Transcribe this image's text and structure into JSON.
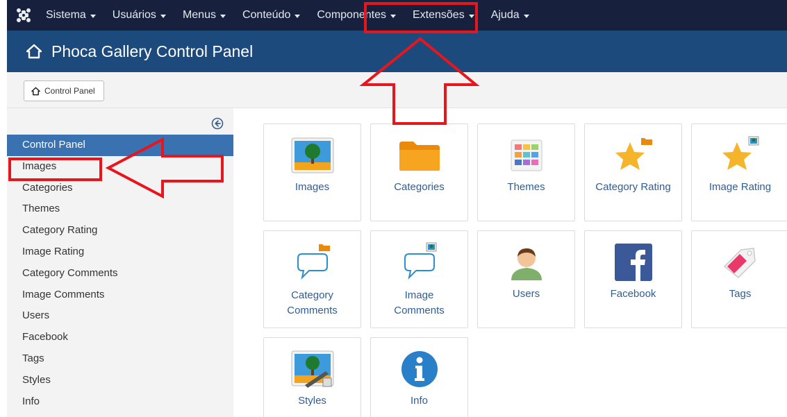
{
  "topnav": {
    "menu": [
      {
        "label": "Sistema"
      },
      {
        "label": "Usuários"
      },
      {
        "label": "Menus"
      },
      {
        "label": "Conteúdo"
      },
      {
        "label": "Componentes"
      },
      {
        "label": "Extensões"
      },
      {
        "label": "Ajuda"
      }
    ]
  },
  "titlebar": {
    "title": "Phoca Gallery Control Panel",
    "icon": "home-icon"
  },
  "toolbar": {
    "control_panel_label": "Control Panel"
  },
  "sidebar": {
    "items": [
      {
        "label": "Control Panel",
        "active": true
      },
      {
        "label": "Images"
      },
      {
        "label": "Categories"
      },
      {
        "label": "Themes"
      },
      {
        "label": "Category Rating"
      },
      {
        "label": "Image Rating"
      },
      {
        "label": "Category Comments"
      },
      {
        "label": "Image Comments"
      },
      {
        "label": "Users"
      },
      {
        "label": "Facebook"
      },
      {
        "label": "Tags"
      },
      {
        "label": "Styles"
      },
      {
        "label": "Info"
      }
    ]
  },
  "tiles": [
    {
      "label": "Images",
      "icon": "image-icon"
    },
    {
      "label": "Categories",
      "icon": "folder-icon"
    },
    {
      "label": "Themes",
      "icon": "themes-grid-icon"
    },
    {
      "label": "Category Rating",
      "icon": "star-folder-icon"
    },
    {
      "label": "Image Rating",
      "icon": "star-image-icon"
    },
    {
      "label": "Category\nComments",
      "icon": "comment-folder-icon"
    },
    {
      "label": "Image\nComments",
      "icon": "comment-image-icon"
    },
    {
      "label": "Users",
      "icon": "user-icon"
    },
    {
      "label": "Facebook",
      "icon": "facebook-icon"
    },
    {
      "label": "Tags",
      "icon": "tag-icon"
    },
    {
      "label": "Styles",
      "icon": "styles-icon"
    },
    {
      "label": "Info",
      "icon": "info-icon"
    }
  ],
  "colors": {
    "navbar": "#17213d",
    "titlebar": "#1c4a7c",
    "active_item": "#3a71b1",
    "tile_label": "#2f5d95",
    "annotation_red": "#e8161c"
  }
}
